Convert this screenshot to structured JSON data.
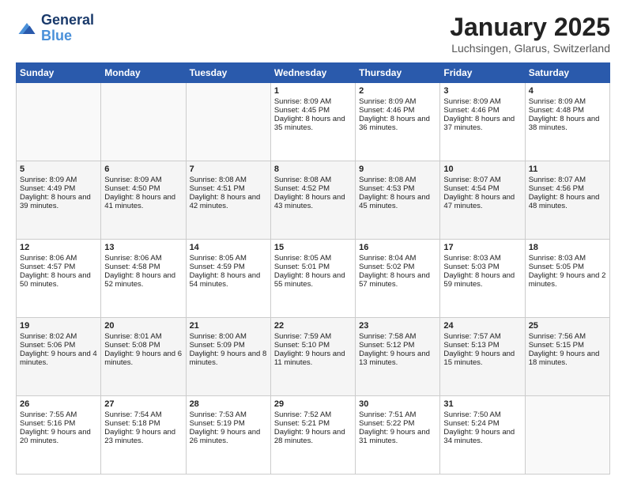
{
  "header": {
    "logo_line1": "General",
    "logo_line2": "Blue",
    "month": "January 2025",
    "location": "Luchsingen, Glarus, Switzerland"
  },
  "weekdays": [
    "Sunday",
    "Monday",
    "Tuesday",
    "Wednesday",
    "Thursday",
    "Friday",
    "Saturday"
  ],
  "weeks": [
    [
      {
        "day": "",
        "info": ""
      },
      {
        "day": "",
        "info": ""
      },
      {
        "day": "",
        "info": ""
      },
      {
        "day": "1",
        "info": "Sunrise: 8:09 AM\nSunset: 4:45 PM\nDaylight: 8 hours and 35 minutes."
      },
      {
        "day": "2",
        "info": "Sunrise: 8:09 AM\nSunset: 4:46 PM\nDaylight: 8 hours and 36 minutes."
      },
      {
        "day": "3",
        "info": "Sunrise: 8:09 AM\nSunset: 4:46 PM\nDaylight: 8 hours and 37 minutes."
      },
      {
        "day": "4",
        "info": "Sunrise: 8:09 AM\nSunset: 4:48 PM\nDaylight: 8 hours and 38 minutes."
      }
    ],
    [
      {
        "day": "5",
        "info": "Sunrise: 8:09 AM\nSunset: 4:49 PM\nDaylight: 8 hours and 39 minutes."
      },
      {
        "day": "6",
        "info": "Sunrise: 8:09 AM\nSunset: 4:50 PM\nDaylight: 8 hours and 41 minutes."
      },
      {
        "day": "7",
        "info": "Sunrise: 8:08 AM\nSunset: 4:51 PM\nDaylight: 8 hours and 42 minutes."
      },
      {
        "day": "8",
        "info": "Sunrise: 8:08 AM\nSunset: 4:52 PM\nDaylight: 8 hours and 43 minutes."
      },
      {
        "day": "9",
        "info": "Sunrise: 8:08 AM\nSunset: 4:53 PM\nDaylight: 8 hours and 45 minutes."
      },
      {
        "day": "10",
        "info": "Sunrise: 8:07 AM\nSunset: 4:54 PM\nDaylight: 8 hours and 47 minutes."
      },
      {
        "day": "11",
        "info": "Sunrise: 8:07 AM\nSunset: 4:56 PM\nDaylight: 8 hours and 48 minutes."
      }
    ],
    [
      {
        "day": "12",
        "info": "Sunrise: 8:06 AM\nSunset: 4:57 PM\nDaylight: 8 hours and 50 minutes."
      },
      {
        "day": "13",
        "info": "Sunrise: 8:06 AM\nSunset: 4:58 PM\nDaylight: 8 hours and 52 minutes."
      },
      {
        "day": "14",
        "info": "Sunrise: 8:05 AM\nSunset: 4:59 PM\nDaylight: 8 hours and 54 minutes."
      },
      {
        "day": "15",
        "info": "Sunrise: 8:05 AM\nSunset: 5:01 PM\nDaylight: 8 hours and 55 minutes."
      },
      {
        "day": "16",
        "info": "Sunrise: 8:04 AM\nSunset: 5:02 PM\nDaylight: 8 hours and 57 minutes."
      },
      {
        "day": "17",
        "info": "Sunrise: 8:03 AM\nSunset: 5:03 PM\nDaylight: 8 hours and 59 minutes."
      },
      {
        "day": "18",
        "info": "Sunrise: 8:03 AM\nSunset: 5:05 PM\nDaylight: 9 hours and 2 minutes."
      }
    ],
    [
      {
        "day": "19",
        "info": "Sunrise: 8:02 AM\nSunset: 5:06 PM\nDaylight: 9 hours and 4 minutes."
      },
      {
        "day": "20",
        "info": "Sunrise: 8:01 AM\nSunset: 5:08 PM\nDaylight: 9 hours and 6 minutes."
      },
      {
        "day": "21",
        "info": "Sunrise: 8:00 AM\nSunset: 5:09 PM\nDaylight: 9 hours and 8 minutes."
      },
      {
        "day": "22",
        "info": "Sunrise: 7:59 AM\nSunset: 5:10 PM\nDaylight: 9 hours and 11 minutes."
      },
      {
        "day": "23",
        "info": "Sunrise: 7:58 AM\nSunset: 5:12 PM\nDaylight: 9 hours and 13 minutes."
      },
      {
        "day": "24",
        "info": "Sunrise: 7:57 AM\nSunset: 5:13 PM\nDaylight: 9 hours and 15 minutes."
      },
      {
        "day": "25",
        "info": "Sunrise: 7:56 AM\nSunset: 5:15 PM\nDaylight: 9 hours and 18 minutes."
      }
    ],
    [
      {
        "day": "26",
        "info": "Sunrise: 7:55 AM\nSunset: 5:16 PM\nDaylight: 9 hours and 20 minutes."
      },
      {
        "day": "27",
        "info": "Sunrise: 7:54 AM\nSunset: 5:18 PM\nDaylight: 9 hours and 23 minutes."
      },
      {
        "day": "28",
        "info": "Sunrise: 7:53 AM\nSunset: 5:19 PM\nDaylight: 9 hours and 26 minutes."
      },
      {
        "day": "29",
        "info": "Sunrise: 7:52 AM\nSunset: 5:21 PM\nDaylight: 9 hours and 28 minutes."
      },
      {
        "day": "30",
        "info": "Sunrise: 7:51 AM\nSunset: 5:22 PM\nDaylight: 9 hours and 31 minutes."
      },
      {
        "day": "31",
        "info": "Sunrise: 7:50 AM\nSunset: 5:24 PM\nDaylight: 9 hours and 34 minutes."
      },
      {
        "day": "",
        "info": ""
      }
    ]
  ]
}
